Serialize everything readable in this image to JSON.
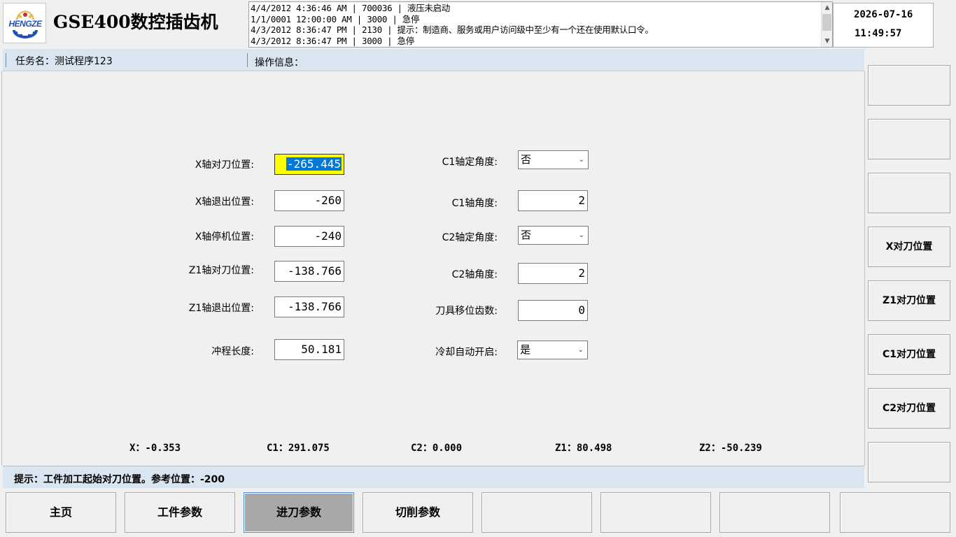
{
  "header": {
    "logo_text": "HENGZE",
    "app_title": "GSE400数控插齿机",
    "log_lines": [
      "4/4/2012 4:36:46 AM  | 700036 | 液压未启动",
      "1/1/0001 12:00:00 AM | 3000  | 急停",
      "4/3/2012 8:36:47 PM  | 2130  | 提示：制造商、服务或用户访问级中至少有一个还在使用默认口令。",
      "4/3/2012 8:36:47 PM  | 3000  | 急停"
    ],
    "date": "2026-07-16",
    "time": "11:49:57"
  },
  "info_bar": {
    "task": "任务名：测试程序123",
    "operation": "操作信息："
  },
  "form": {
    "x_tool_pos": {
      "label": "X轴对刀位置:",
      "value": "-265.445"
    },
    "x_retract_pos": {
      "label": "X轴退出位置:",
      "value": "-260"
    },
    "x_stop_pos": {
      "label": "X轴停机位置:",
      "value": "-240"
    },
    "z1_tool_pos": {
      "label": "Z1轴对刀位置:",
      "value": "-138.766"
    },
    "z1_retract_pos": {
      "label": "Z1轴退出位置:",
      "value": "-138.766"
    },
    "stroke_length": {
      "label": "冲程长度:",
      "value": "50.181"
    },
    "c1_fixed_angle": {
      "label": "C1轴定角度:",
      "value": "否"
    },
    "c1_angle": {
      "label": "C1轴角度:",
      "value": "2"
    },
    "c2_fixed_angle": {
      "label": "C2轴定角度:",
      "value": "否"
    },
    "c2_angle": {
      "label": "C2轴角度:",
      "value": "2"
    },
    "tool_shift_teeth": {
      "label": "刀具移位齿数:",
      "value": "0"
    },
    "coolant_auto": {
      "label": "冷却自动开启:",
      "value": "是"
    }
  },
  "positions": {
    "x": "X：-0.353",
    "c1": "C1：291.075",
    "c2": "C2：0.000",
    "z1": "Z1：80.498",
    "z2": "Z2：-50.239"
  },
  "hint": "提示：工件加工起始对刀位置。参考位置：-200",
  "side_buttons": [
    "",
    "",
    "",
    "X对刀位置",
    "Z1对刀位置",
    "C1对刀位置",
    "C2对刀位置",
    ""
  ],
  "nav_buttons": [
    "主页",
    "工件参数",
    "进刀参数",
    "切削参数",
    "",
    "",
    "",
    ""
  ],
  "active_nav": "进刀参数",
  "colors": {
    "bar_bg": "#d9e5f1",
    "active_field": "#ffff00",
    "selection": "#0078d7",
    "logo_blue": "#1f52b6",
    "logo_gold": "#e4b84a",
    "logo_red": "#d9232a"
  }
}
